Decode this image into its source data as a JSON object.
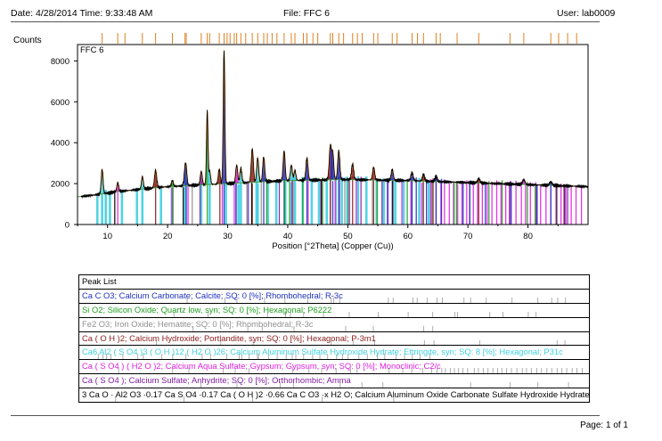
{
  "header": {
    "datetime": "Date: 4/28/2014 Time: 9:33:48 AM",
    "file": "File: FFC 6",
    "user": "User: lab0009"
  },
  "footer": {
    "page": "Page: 1 of 1"
  },
  "colors": {
    "trace": "#000000",
    "calculated": "#e08020",
    "background_line": "#40a040",
    "calcite": "#2030c0",
    "quartz": "#20a020",
    "hematite": "#909090",
    "portlandite": "#8b2020",
    "ettringite": "#40d0e0",
    "gypsum": "#e020e0",
    "anhydrite": "#8020a0",
    "afm": "#000000"
  },
  "chart_data": {
    "type": "line",
    "title": "",
    "sample_label": "FFC 6",
    "xlabel": "Position [°2Theta] (Copper (Cu))",
    "ylabel": "Counts",
    "xlim": [
      5,
      90
    ],
    "ylim": [
      0,
      8800
    ],
    "xticks": [
      10,
      20,
      30,
      40,
      50,
      60,
      70,
      80
    ],
    "yticks": [
      0,
      2000,
      4000,
      6000,
      8000
    ],
    "grid": false,
    "baseline": [
      [
        5,
        1350
      ],
      [
        8,
        1450
      ],
      [
        12,
        1620
      ],
      [
        20,
        1850
      ],
      [
        30,
        2000
      ],
      [
        40,
        2150
      ],
      [
        50,
        2200
      ],
      [
        60,
        2150
      ],
      [
        70,
        2050
      ],
      [
        80,
        1950
      ],
      [
        90,
        1850
      ]
    ],
    "peaks": [
      {
        "x": 9.1,
        "y": 2700,
        "w": 0.15,
        "color": "#40d0e0"
      },
      {
        "x": 11.7,
        "y": 2050,
        "w": 0.15,
        "color": "#e020e0"
      },
      {
        "x": 15.8,
        "y": 2350,
        "w": 0.15,
        "color": "#40d0e0"
      },
      {
        "x": 18.0,
        "y": 2650,
        "w": 0.18,
        "color": "#8b2020"
      },
      {
        "x": 20.8,
        "y": 2150,
        "w": 0.15,
        "color": "#20a020"
      },
      {
        "x": 22.9,
        "y": 2650,
        "w": 0.16,
        "color": "#40d0e0"
      },
      {
        "x": 23.1,
        "y": 2500,
        "w": 0.15,
        "color": "#2030c0"
      },
      {
        "x": 25.6,
        "y": 2600,
        "w": 0.16,
        "color": "#8020a0"
      },
      {
        "x": 26.6,
        "y": 5550,
        "w": 0.12,
        "color": "#20a020"
      },
      {
        "x": 27.0,
        "y": 2600,
        "w": 0.15,
        "color": "#40d0e0"
      },
      {
        "x": 28.6,
        "y": 2700,
        "w": 0.16,
        "color": "#8b2020"
      },
      {
        "x": 29.4,
        "y": 8500,
        "w": 0.13,
        "color": "#2030c0"
      },
      {
        "x": 31.5,
        "y": 2900,
        "w": 0.16,
        "color": "#e020e0"
      },
      {
        "x": 32.2,
        "y": 2750,
        "w": 0.16,
        "color": "#40d0e0"
      },
      {
        "x": 34.1,
        "y": 3700,
        "w": 0.17,
        "color": "#8b2020"
      },
      {
        "x": 35.0,
        "y": 3250,
        "w": 0.16,
        "color": "#40d0e0"
      },
      {
        "x": 36.0,
        "y": 3300,
        "w": 0.16,
        "color": "#2030c0"
      },
      {
        "x": 39.4,
        "y": 3600,
        "w": 0.16,
        "color": "#2030c0"
      },
      {
        "x": 40.6,
        "y": 2900,
        "w": 0.16,
        "color": "#40d0e0"
      },
      {
        "x": 41.2,
        "y": 2650,
        "w": 0.15,
        "color": "#40d0e0"
      },
      {
        "x": 43.2,
        "y": 3250,
        "w": 0.17,
        "color": "#2030c0"
      },
      {
        "x": 47.1,
        "y": 3850,
        "w": 0.18,
        "color": "#8b2020"
      },
      {
        "x": 47.5,
        "y": 3450,
        "w": 0.16,
        "color": "#2030c0"
      },
      {
        "x": 48.5,
        "y": 3600,
        "w": 0.17,
        "color": "#2030c0"
      },
      {
        "x": 50.8,
        "y": 2950,
        "w": 0.17,
        "color": "#8b2020"
      },
      {
        "x": 54.3,
        "y": 2800,
        "w": 0.17,
        "color": "#8b2020"
      },
      {
        "x": 57.4,
        "y": 2700,
        "w": 0.17,
        "color": "#2030c0"
      },
      {
        "x": 60.7,
        "y": 2550,
        "w": 0.18,
        "color": "#2030c0"
      },
      {
        "x": 62.6,
        "y": 2450,
        "w": 0.18,
        "color": "#8b2020"
      },
      {
        "x": 64.7,
        "y": 2350,
        "w": 0.18,
        "color": "#2030c0"
      },
      {
        "x": 71.8,
        "y": 2250,
        "w": 0.2,
        "color": "#8b2020"
      },
      {
        "x": 79.3,
        "y": 2200,
        "w": 0.2,
        "color": "#e020e0"
      },
      {
        "x": 83.8,
        "y": 2100,
        "w": 0.2,
        "color": "#2030c0"
      }
    ],
    "reference_lines": [
      {
        "color": "#40d0e0",
        "x": [
          8.3,
          9.1,
          9.7,
          10.4,
          12.4,
          14.9,
          15.8,
          18.9,
          20.7,
          22.9,
          25.6,
          27.0,
          29.7,
          31.8,
          32.2,
          33.4,
          34.8,
          35.0,
          36.7,
          38.1,
          39.6,
          40.6,
          41.2,
          42.5,
          44.0,
          45.2,
          46.5,
          48.0,
          49.0,
          49.9,
          51.7,
          53.1,
          54.8,
          56.0,
          57.9,
          59.3,
          60.6,
          61.9,
          63.5
        ]
      },
      {
        "color": "#e020e0",
        "x": [
          11.7,
          20.7,
          23.4,
          29.1,
          31.1,
          33.4,
          40.7,
          43.4,
          45.5,
          47.9,
          50.3,
          51.4,
          56.7,
          59.0,
          60.5,
          62.3,
          63.8,
          64.7,
          65.5,
          66.1,
          66.9,
          67.6,
          68.3,
          69.0,
          69.8,
          70.9,
          71.6,
          72.4,
          73.2,
          74.0,
          74.8,
          75.5,
          76.3,
          77.1,
          78.0,
          78.9,
          79.6,
          80.4,
          81.3,
          82.1,
          83.0,
          83.8,
          84.7,
          85.5,
          86.3,
          87.2,
          88.0,
          88.9
        ]
      },
      {
        "color": "#8020a0",
        "x": [
          25.4,
          31.4,
          38.6,
          40.8,
          48.6,
          52.2,
          55.7,
          70.3,
          76.9,
          81.5,
          86.6
        ]
      },
      {
        "color": "#2030c0",
        "x": [
          23.1,
          29.4,
          31.4,
          36.0,
          39.4,
          43.2,
          47.1,
          47.5,
          48.5,
          56.6,
          57.4,
          60.7,
          61.4,
          63.1,
          64.7,
          65.6,
          69.2,
          70.3,
          72.9,
          77.2,
          81.5,
          83.8,
          84.8,
          86.1
        ]
      },
      {
        "color": "#20a020",
        "x": [
          20.9,
          26.6,
          36.5,
          39.5,
          40.3,
          42.5,
          45.8,
          50.1,
          54.9,
          59.9,
          64.0,
          67.7,
          68.1,
          73.5,
          75.7,
          79.9,
          81.2
        ]
      },
      {
        "color": "#8b2020",
        "x": [
          18.0,
          28.7,
          34.1,
          47.1,
          50.8,
          54.3,
          62.6,
          64.2,
          71.8,
          84.7,
          86.0
        ]
      },
      {
        "color": "#909090",
        "x": [
          24.1,
          33.2,
          35.6,
          40.9,
          49.5,
          54.1,
          62.5,
          64.0
        ]
      },
      {
        "color": "#000000",
        "x": [
          11.2,
          22.6,
          34.0,
          45.6,
          57.5
        ]
      }
    ],
    "top_ticks_color": "#e08020",
    "top_ticks_x": [
      9.1,
      11.7,
      12.9,
      15.8,
      18.0,
      20.8,
      22.9,
      23.1,
      25.6,
      26.6,
      27.0,
      28.6,
      29.4,
      29.9,
      30.4,
      31.1,
      31.5,
      32.2,
      33.0,
      34.1,
      35.0,
      36.0,
      36.6,
      37.4,
      38.2,
      39.4,
      40.6,
      41.2,
      42.6,
      43.2,
      44.2,
      45.0,
      47.1,
      47.5,
      48.5,
      49.3,
      50.8,
      51.6,
      52.4,
      54.3,
      55.0,
      57.4,
      58.2,
      60.7,
      61.6,
      62.6,
      64.7,
      65.4,
      68.2,
      71.8,
      77.0,
      79.3,
      83.8,
      85.1,
      86.6,
      88.1
    ],
    "phases": [
      {
        "name": "Ca C O3; Calcium Carbonate; Calcite; SQ: 0 [%]; Rhombohedral; R-3c",
        "color": "#2030c0"
      },
      {
        "name": "Si O2; Silicon Oxide; Quartz low, syn; SQ: 0 [%]; Hexagonal; P6222",
        "color": "#20a020"
      },
      {
        "name": "Fe2 O3; Iron Oxide; Hematite; SQ: 0 [%]; Rhombohedral; R-3c",
        "color": "#909090"
      },
      {
        "name": "Ca ( O H )2; Calcium Hydroxide; Portlandite, syn; SQ: 0 [%]; Hexagonal; P-3m1",
        "color": "#8b2020"
      },
      {
        "name": "Ca6 Al2 ( S O4 )3 ( O H )12 ( H2 O )26; Calcium Aluminum Sulfate Hydroxide Hydrate; Ettringite, syn; SQ: 8 [%]; Hexagonal; P31c",
        "color": "#40d0e0"
      },
      {
        "name": "Ca ( S O4 ) ( H2 O )2; Calcium Aqua Sulfate; Gypsum; Gypsum, syn; SQ: 0 [%]; Monoclinic; C2/c",
        "color": "#e020e0"
      },
      {
        "name": "Ca ( S O4 ); Calcium Sulfate; Anhydrite; SQ: 0 [%]; Orthorhombic; Amma",
        "color": "#8020a0"
      },
      {
        "name": "3 Ca O · Al2 O3 ·0.17 Ca S O4 ·0.17 Ca ( O H )2 ·0.66 Ca C O3 ·x H2 O; Calcium Aluminum Oxide Carbonate Sulfate Hydroxide Hydrate; SQ: 0 [%]",
        "color": "#000000"
      }
    ],
    "table_header": "Peak List"
  }
}
